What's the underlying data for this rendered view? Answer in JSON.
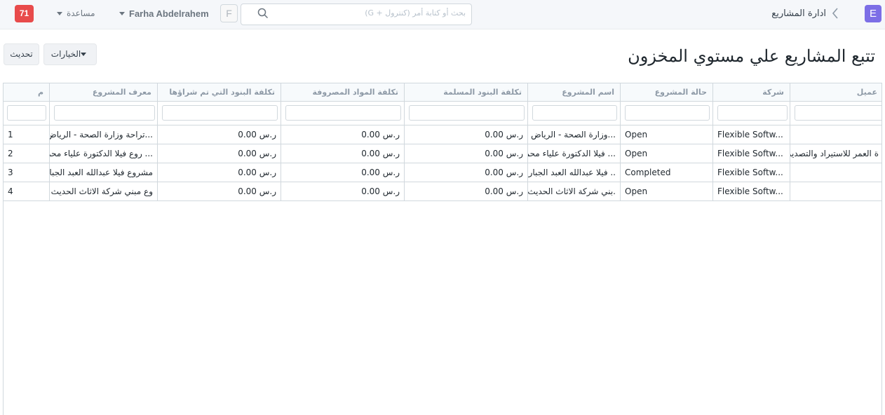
{
  "navbar": {
    "logo_letter": "E",
    "breadcrumb": "ادارة المشاريع",
    "search_placeholder": "بحث أو كتابة أمر (كنترول + G)",
    "avatar_letter": "F",
    "user_name": "Farha Abdelrahem",
    "help_label": "مساعدة",
    "notification_count": "71"
  },
  "page": {
    "title": "تتبع المشاريع علي مستوي المخزون",
    "options_label": "الخيارات",
    "refresh_label": "تحديث"
  },
  "table": {
    "columns": {
      "customer": "عميل",
      "company": "شركة",
      "status": "حالة المشروع",
      "project_name": "اسم المشروع",
      "delivered_cost": "تكلفة البنود المسلمة",
      "consumed_cost": "تكلفة المواد المصروفة",
      "purchased_cost": "تكلفة البنود التي تم شراؤها",
      "project_id": "معرف المشروع",
      "row_no": "م"
    },
    "rows": [
      {
        "customer": "",
        "company": "Flexible Softw...",
        "status": "Open",
        "project_name": "...وزارة الصحة - الرياض",
        "delivered_cost": "ر.س 0.00",
        "consumed_cost": "ر.س 0.00",
        "purchased_cost": "ر.س 0.00",
        "project_id": "...تراحة وزارة الصحة - الرياض",
        "row_no": "1"
      },
      {
        "customer": "ة العمر للاستيراد والتصدير",
        "company": "Flexible Softw...",
        "status": "Open",
        "project_name": "... فيلا الدكتورة علياء محمد",
        "delivered_cost": "ر.س 0.00",
        "consumed_cost": "ر.س 0.00",
        "purchased_cost": "ر.س 0.00",
        "project_id": "... روع فيلا الدكتورة علياء محمد",
        "row_no": "2"
      },
      {
        "customer": "",
        "company": "Flexible Softw...",
        "status": "Completed",
        "project_name": "..  فيلا عبدالله العبد الجبار",
        "delivered_cost": "ر.س 0.00",
        "consumed_cost": "ر.س 0.00",
        "purchased_cost": "ر.س 0.00",
        "project_id": "مشروع فيلا عبدالله العبد الجبار",
        "row_no": "3"
      },
      {
        "customer": "",
        "company": "Flexible Softw...",
        "status": "Open",
        "project_name": ".بني شركة الاثاث الحديث",
        "delivered_cost": "ر.س 0.00",
        "consumed_cost": "ر.س 0.00",
        "purchased_cost": "ر.س 0.00",
        "project_id": "وع مبني شركة الاثاث الحديث",
        "row_no": "4"
      }
    ]
  }
}
